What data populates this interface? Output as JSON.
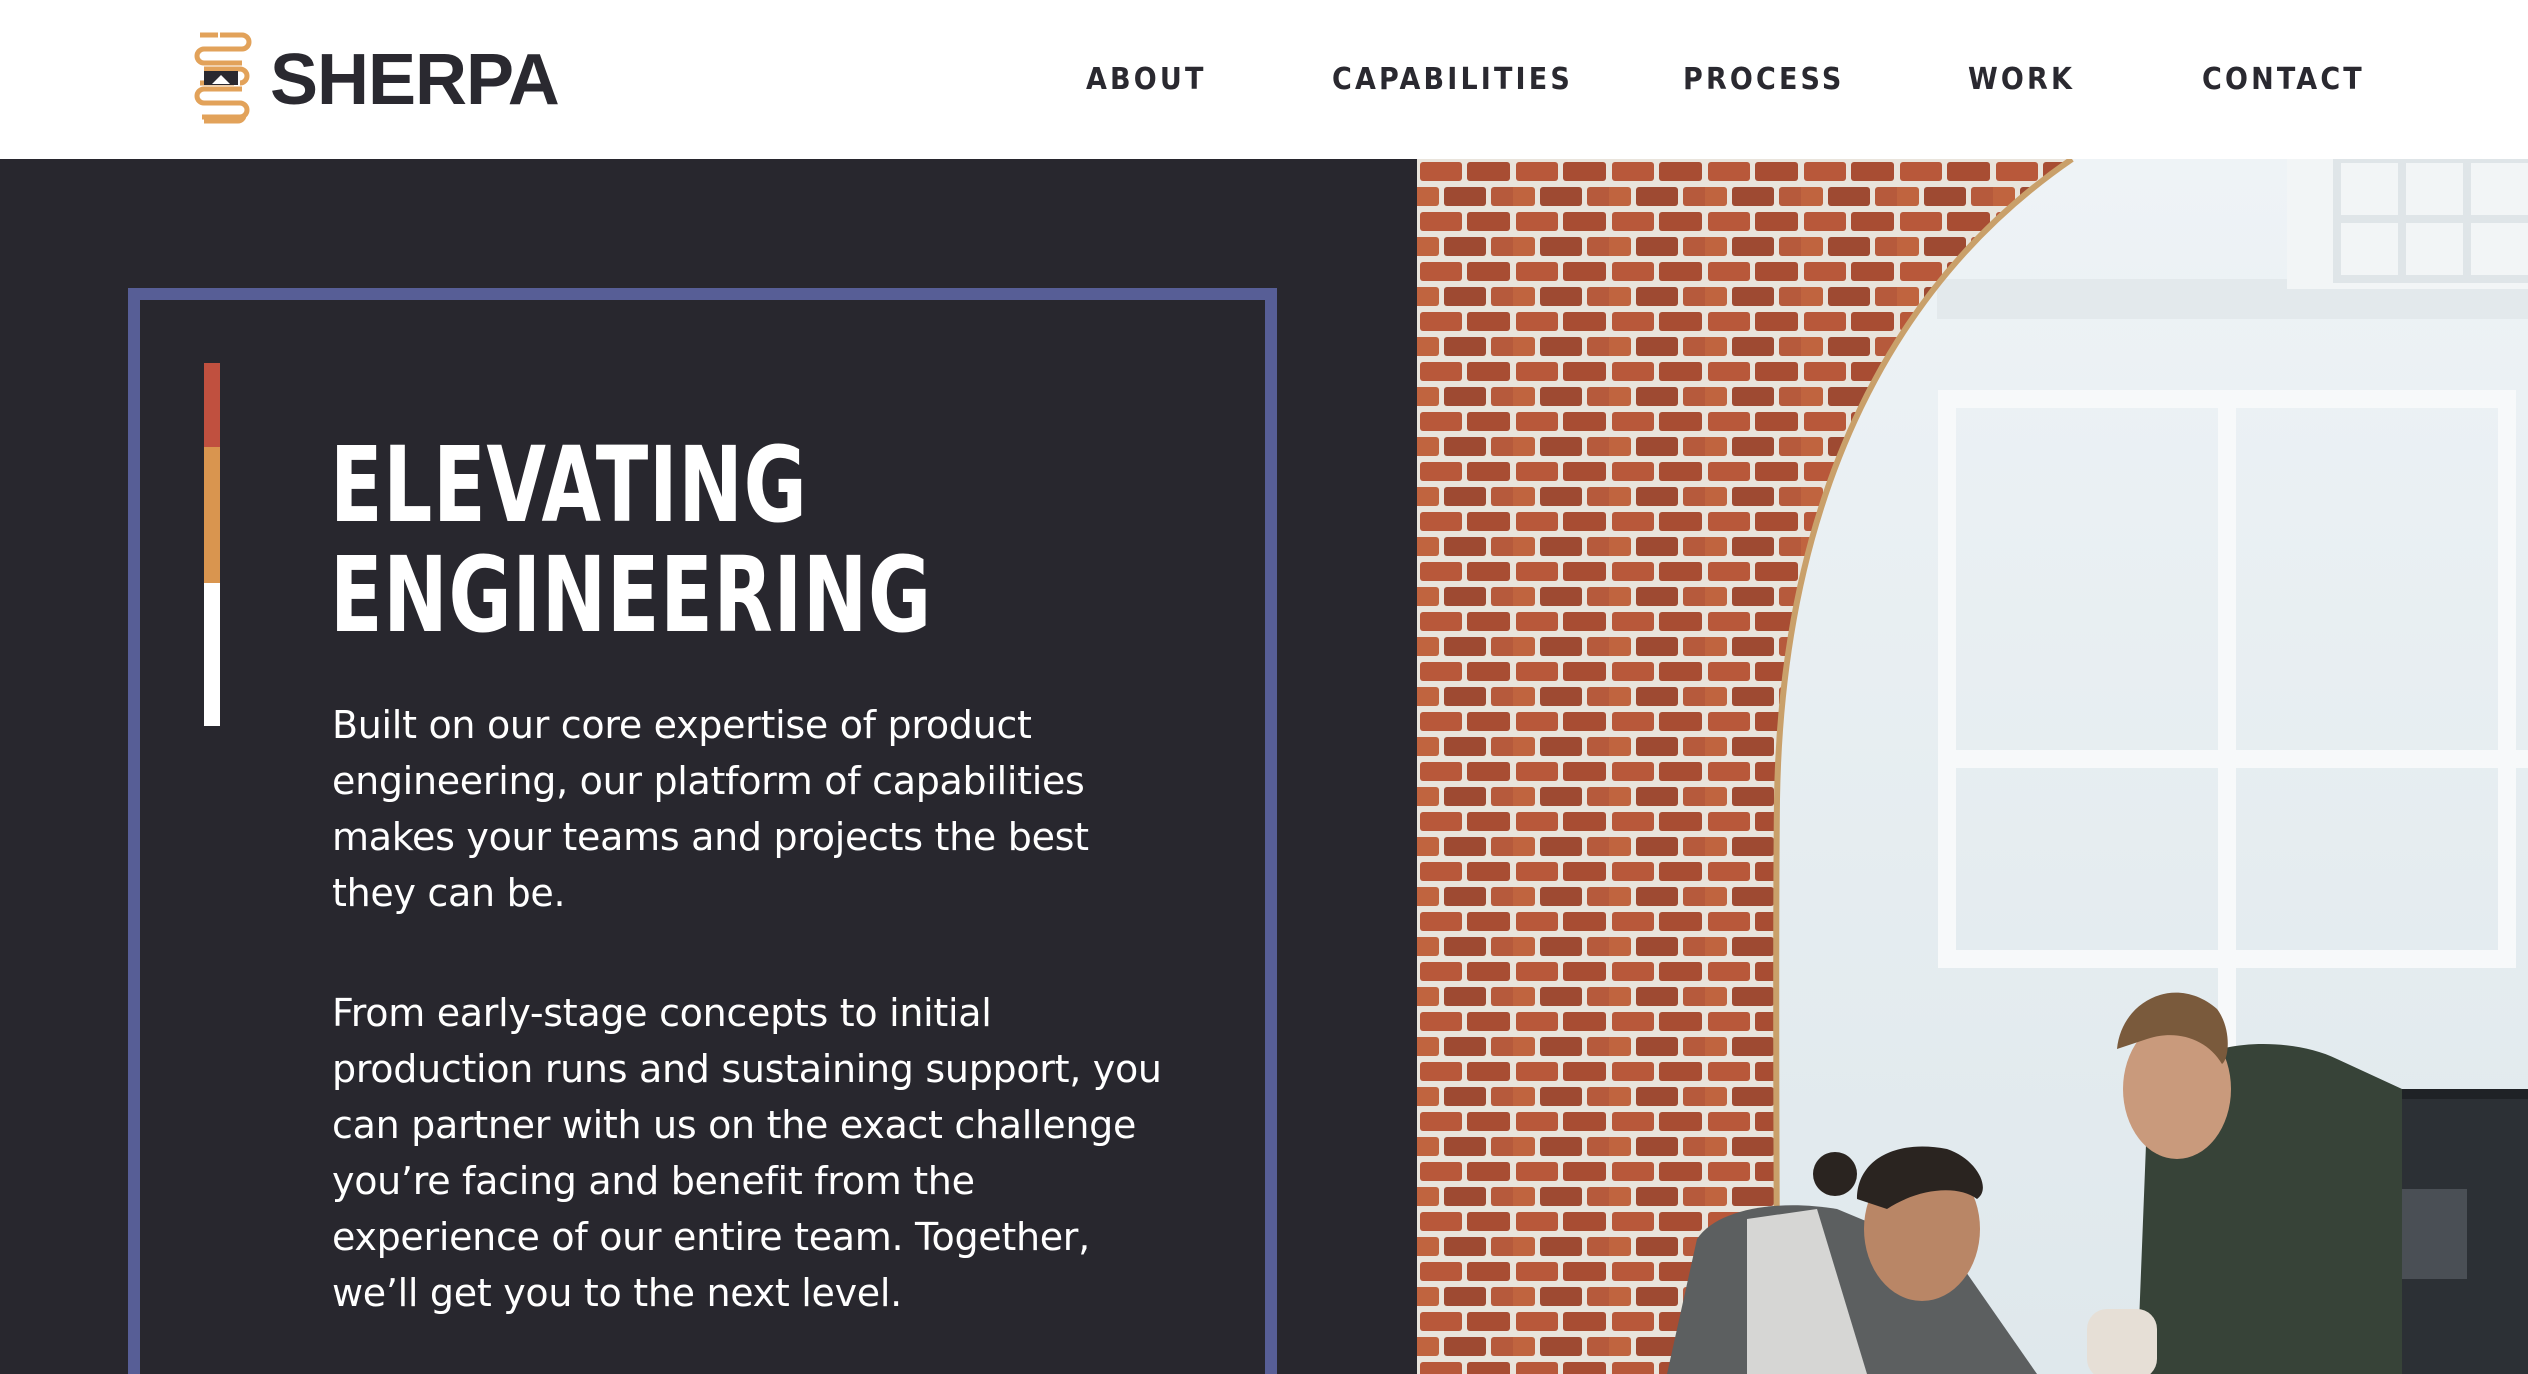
{
  "brand": {
    "name": "SHERPA",
    "logo_icon": "sherpa-stacked-chevron-logo",
    "colors": {
      "logo_gold": "#e2a25a",
      "dark": "#2a2930",
      "panel": "#28272e",
      "frame": "#575e96",
      "accent_red": "#c0503f",
      "accent_orange": "#d9954f"
    }
  },
  "nav": {
    "items": [
      {
        "label": "ABOUT"
      },
      {
        "label": "CAPABILITIES"
      },
      {
        "label": "PROCESS"
      },
      {
        "label": "WORK"
      },
      {
        "label": "CONTACT"
      }
    ]
  },
  "hero": {
    "title_line1": "ELEVATING",
    "title_line2": "ENGINEERING",
    "paragraph1": "Built on our core expertise of product engineering, our platform of capabilities makes your teams and projects the best they can be.",
    "paragraph2": "From early-stage concepts to initial production runs and sustaining support, you can partner with us on the exact challenge you’re facing and benefit from the experience of our entire team. Together, we’ll get you to the next level.",
    "image": "photo-two-engineers-at-monitor-brick-arch"
  }
}
